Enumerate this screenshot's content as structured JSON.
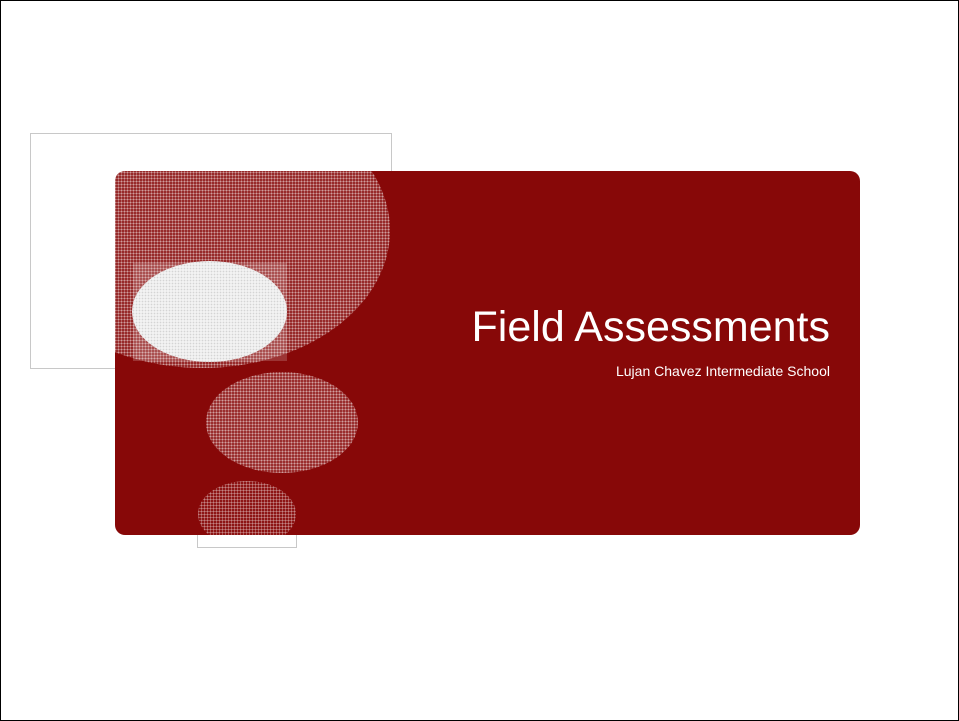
{
  "slide": {
    "title": "Field Assessments",
    "subtitle": "Lujan Chavez  Intermediate School"
  },
  "colors": {
    "banner": "#870808",
    "text": "#ffffff",
    "outline": "#c8c8c8"
  }
}
